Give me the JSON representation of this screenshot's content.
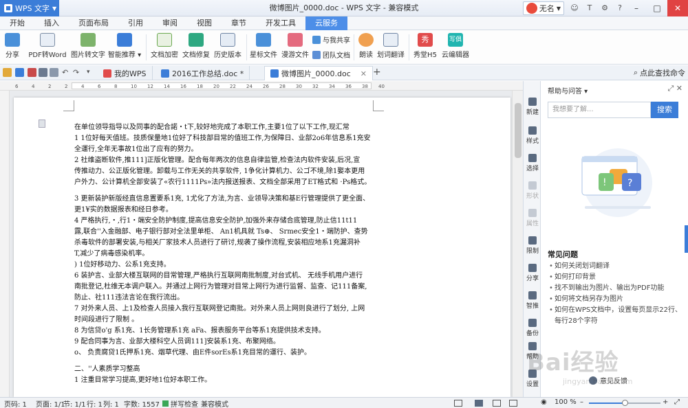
{
  "app": {
    "menu_label": "WPS 文字",
    "title": "微博图片_0000.doc - WPS 文字 - 兼容模式",
    "user_name": "无名"
  },
  "menu_tabs": [
    "开始",
    "插入",
    "页面布局",
    "引用",
    "审阅",
    "视图",
    "章节",
    "开发工具",
    "云服务"
  ],
  "active_menu_tab": "云服务",
  "ribbon": {
    "share": "分享",
    "pdf_to_word": "PDF转Word",
    "image_to_text": "图片转文字",
    "smart_recommend": "智能推荐",
    "doc_encrypt": "文档加密",
    "doc_repair": "文档修复",
    "history": "历史版本",
    "star_file": "星标文件",
    "roam_file": "漫游文件",
    "share_with_me": "与我共享",
    "team_doc": "团队文档",
    "read_aloud": "朗读",
    "word_translate": "划词翻译",
    "show_h5": "秀堂H5",
    "cloud_editor": "云编辑器",
    "show_tag": "秀",
    "editor_tag": "写俱"
  },
  "doc_tabs": [
    {
      "label": "我的WPS"
    },
    {
      "label": "2016工作总结.doc *"
    },
    {
      "label": "微博图片_0000.doc"
    }
  ],
  "find_command": "点此查找命令",
  "ruler_numbers": [
    "6",
    "4",
    "2",
    "2",
    "4",
    "6",
    "8",
    "10",
    "12",
    "14",
    "16",
    "18",
    "20",
    "22",
    "24",
    "26",
    "28",
    "30",
    "32",
    "34",
    "36",
    "38",
    "40"
  ],
  "document": {
    "lines": [
      "在单位领导指导以及同事的配合諾・t下,较好地完成了本职工作,主要1位了以下工作,现汇常",
      "1 1位好每天值班。技质保量地1位好了科技部目常的值班工作,为保障日、业部2o6年信息系1充安",
      "全運行,全年无事故1位出了应有的努力。",
      "2 社维盗断软件,推111]正版化管理。配合每年两次的信息自律监管,检查法内软件安装,后况,宣",
      "传推动力、公正版化管理。卸载与工作无关的共享软件, 1争化计算机力、公ゴ不境,除1娶本更用",
      "户外力、公计算机全部安装了«农行1111Ps»法内报送报表、文档全部采用了ET格式和 ·Ps格式。",
      "",
      "3 更新装护新版经直信息置要系1充, 1尤化了方法,为言、业领导决策和基E行管理提供了更全面、",
      "更1¥实的数据报表和经日参考。",
      "4 严格执行,・,行1・端安全防护制度,提高信息安全防护,加强外来存储合底管理,防止信11t11",
      "露,联合''入金融部、电子银行部对全法里单柜、 An1机具就 Ts⊕、 Srmec安全1・端防护、查势",
      "杀毒软件的部署安装,与相关厂家技术人员进行了研讨,规袭了操作流程,安装相应地系1充漏洞补",
      "T,减少了病毒感染机率。",
      ") 1位好移动力、公系1充支持。",
      "6 装护言、业部大楼互联网的目常管理,严格执行互联网南批制度,对台式机、 无线手机用户进行",
      "南批登记,杜维无本调户联入。并通过上网行为管理对目常上网行为进行监督、监查、记111备案,",
      "防止、社111违法言论在我行流出。",
      "7 对外来人员、上1及检查人员接入我行互联网登记南批。对外来人员上网则良进行了划分, 上网",
      "时间段进行了限制 。",
      "8 为信贷o'g 系1充、1长务管理系1充 aFa、报表服务平台等系1充提供技术支持。",
      "9 配合同事为言、业部大楼科空人员调111]安装系1充、布聚网络。",
      "  o、 负责腐贷1氏押系1充、烟草代理、由E件sorEs系1充目常的運行、装护。",
      "",
      "二、''人素质学习整高",
      "1 注重目常学习提高,更好地1位好本职工作。"
    ]
  },
  "toolstrip": [
    "新建",
    "样式",
    "选择",
    "形状",
    "属性",
    "限制",
    "分享",
    "智推",
    "备份",
    "帮助",
    "设置"
  ],
  "help": {
    "title": "帮助与问答",
    "search_placeholder": "我想要了解...",
    "search_button": "搜索",
    "faq_title": "常见问题",
    "faq": [
      "如何关闭划词翻译",
      "如何打印背景",
      "找不到输出为图片、输出为PDF功能",
      "如何将文档另存为图片",
      "如何在WPS文档中，设置每页显示22行、每行28个字符"
    ],
    "feedback": "意见反馈"
  },
  "status": {
    "page_num": "页码: 1",
    "page": "页面: 1/1",
    "section": "节: 1/1",
    "row": "行: 1",
    "col": "列: 1",
    "words": "字数: 1557",
    "spell": "拼写检查",
    "compat": "兼容模式",
    "zoom": "100 %",
    "zoom_level": 0.5
  },
  "watermark": {
    "big": "Bai经验",
    "small": "jingyan.baidu.com"
  }
}
